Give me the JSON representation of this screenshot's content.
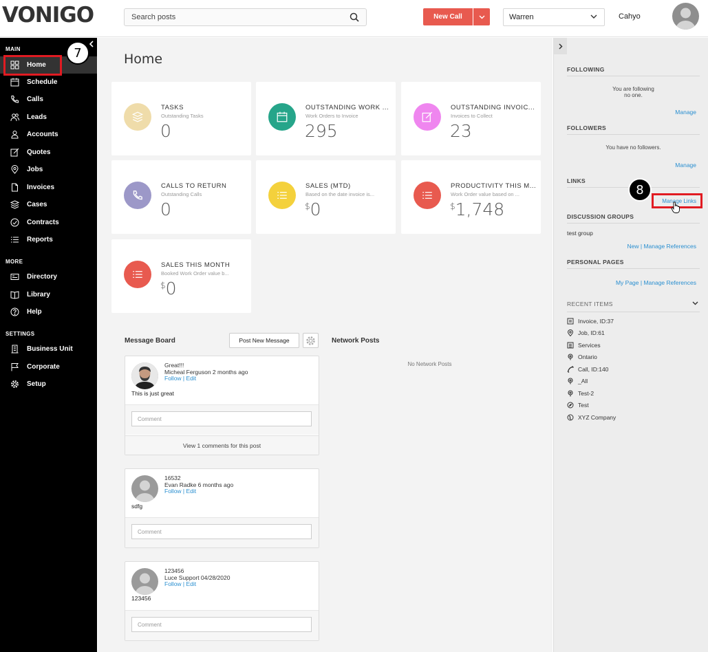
{
  "header": {
    "logo": "VONIGO",
    "search_placeholder": "Search posts",
    "new_call_label": "New Call",
    "user_select": "Warren",
    "username": "Cahyo"
  },
  "sidebar": {
    "main_title": "MAIN",
    "more_title": "MORE",
    "settings_title": "SETTINGS",
    "main_items": [
      {
        "label": "Home",
        "icon": "grid-icon"
      },
      {
        "label": "Schedule",
        "icon": "calendar-icon"
      },
      {
        "label": "Calls",
        "icon": "phone-icon"
      },
      {
        "label": "Leads",
        "icon": "people-icon"
      },
      {
        "label": "Accounts",
        "icon": "person-icon"
      },
      {
        "label": "Quotes",
        "icon": "edit-icon"
      },
      {
        "label": "Jobs",
        "icon": "pin-icon"
      },
      {
        "label": "Invoices",
        "icon": "document-icon"
      },
      {
        "label": "Cases",
        "icon": "layers-icon"
      },
      {
        "label": "Contracts",
        "icon": "check-circle-icon"
      },
      {
        "label": "Reports",
        "icon": "list-icon"
      }
    ],
    "more_items": [
      {
        "label": "Directory",
        "icon": "card-icon"
      },
      {
        "label": "Library",
        "icon": "book-icon"
      },
      {
        "label": "Help",
        "icon": "help-icon"
      }
    ],
    "settings_items": [
      {
        "label": "Business Unit",
        "icon": "building-icon"
      },
      {
        "label": "Corporate",
        "icon": "flag-icon"
      },
      {
        "label": "Setup",
        "icon": "gear-icon"
      }
    ]
  },
  "main": {
    "title": "Home",
    "tiles": [
      {
        "title": "TASKS",
        "sub": "Outstanding Tasks",
        "value": "0",
        "prefix": "",
        "color": "#efdcaa"
      },
      {
        "title": "OUTSTANDING WORK ...",
        "sub": "Work Orders to Invoice",
        "value": "295",
        "prefix": "",
        "color": "#26a58a"
      },
      {
        "title": "OUTSTANDING INVOIC...",
        "sub": "Invoices to Collect",
        "value": "23",
        "prefix": "",
        "color": "#ef86ef"
      },
      {
        "title": "CALLS TO RETURN",
        "sub": "Outstanding Calls",
        "value": "0",
        "prefix": "",
        "color": "#9c98c8"
      },
      {
        "title": "SALES (MTD)",
        "sub": "Based on the date invoice is...",
        "value": "0",
        "prefix": "$",
        "color": "#f4d13c"
      },
      {
        "title": "PRODUCTIVITY THIS M...",
        "sub": "Work Order value based on ...",
        "value": "1,748",
        "prefix": "$",
        "color": "#e85a4f"
      },
      {
        "title": "SALES THIS MONTH",
        "sub": "Booked Work Order value b...",
        "value": "0",
        "prefix": "$",
        "color": "#e85a4f"
      }
    ],
    "message_board_title": "Message Board",
    "post_new_label": "Post New Message",
    "network_posts_title": "Network Posts",
    "no_network_posts": "No Network Posts",
    "comment_placeholder": "Comment",
    "posts": [
      {
        "title": "Great!!!",
        "author": "Micheal Ferguson 2 months ago",
        "links": "Follow | Edit",
        "body": "This is just great",
        "view_comments": "View 1 comments for this post"
      },
      {
        "title": "16532",
        "author": "Evan Radke 6 months ago",
        "links": "Follow | Edit",
        "body": "sdfg"
      },
      {
        "title": "123456",
        "author": "Luce Support 04/28/2020",
        "links": "Follow | Edit",
        "body": "123456"
      }
    ]
  },
  "right": {
    "following_title": "FOLLOWING",
    "following_note1": "You are following",
    "following_note2": "no one.",
    "manage_label": "Manage",
    "followers_title": "FOLLOWERS",
    "followers_note": "You have no followers.",
    "links_title": "LINKS",
    "manage_links_label": "Manage Links",
    "discussion_title": "DISCUSSION GROUPS",
    "discussion_item": "test group",
    "new_manage_refs": "New | Manage References",
    "personal_title": "PERSONAL PAGES",
    "mypage_manage_refs": "My Page | Manage References",
    "recent_title": "RECENT ITEMS",
    "recent_items": [
      {
        "label": "Invoice, ID:37",
        "icon": "document-icon"
      },
      {
        "label": "Job, ID:61",
        "icon": "pin-icon"
      },
      {
        "label": "Services",
        "icon": "box-icon"
      },
      {
        "label": "Ontario",
        "icon": "location-icon"
      },
      {
        "label": "Call, ID:140",
        "icon": "phone-icon"
      },
      {
        "label": "_All",
        "icon": "location-icon"
      },
      {
        "label": "Test-2",
        "icon": "location-icon"
      },
      {
        "label": "Test",
        "icon": "compass-icon"
      },
      {
        "label": "XYZ Company",
        "icon": "globe-icon"
      }
    ]
  },
  "annotations": {
    "badge_a": "7",
    "badge_b": "8"
  },
  "colors": {
    "accent_red": "#e85a4f",
    "link_blue": "#2a8fd0",
    "highlight_red": "#e11b22"
  }
}
